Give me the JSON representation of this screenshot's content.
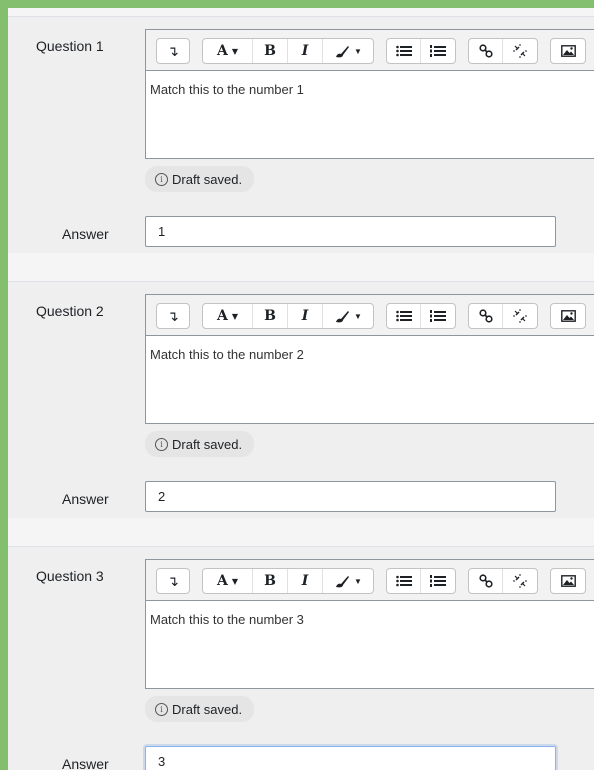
{
  "toolbar": {
    "buttons": [
      {
        "name": "show-more-buttons-icon",
        "label": "↴"
      },
      {
        "name": "font-style-icon",
        "label": "A"
      },
      {
        "name": "bold-icon",
        "label": "B"
      },
      {
        "name": "italic-icon",
        "label": "I"
      },
      {
        "name": "paint-brush-icon",
        "label": ""
      },
      {
        "name": "unordered-list-icon",
        "label": ""
      },
      {
        "name": "ordered-list-icon",
        "label": ""
      },
      {
        "name": "link-icon",
        "label": ""
      },
      {
        "name": "unlink-icon",
        "label": ""
      },
      {
        "name": "image-icon",
        "label": ""
      }
    ]
  },
  "questions": [
    {
      "label": "Question 1",
      "text": "Match this to the number 1",
      "draft": "Draft saved.",
      "answer_label": "Answer",
      "answer_value": "1"
    },
    {
      "label": "Question 2",
      "text": "Match this to the number 2",
      "draft": "Draft saved.",
      "answer_label": "Answer",
      "answer_value": "2"
    },
    {
      "label": "Question 3",
      "text": "Match this to the number 3",
      "draft": "Draft saved.",
      "answer_label": "Answer",
      "answer_value": "3"
    }
  ],
  "colors": {
    "accent_border": "#84bf6f",
    "focus_border": "#8cb3ea"
  }
}
